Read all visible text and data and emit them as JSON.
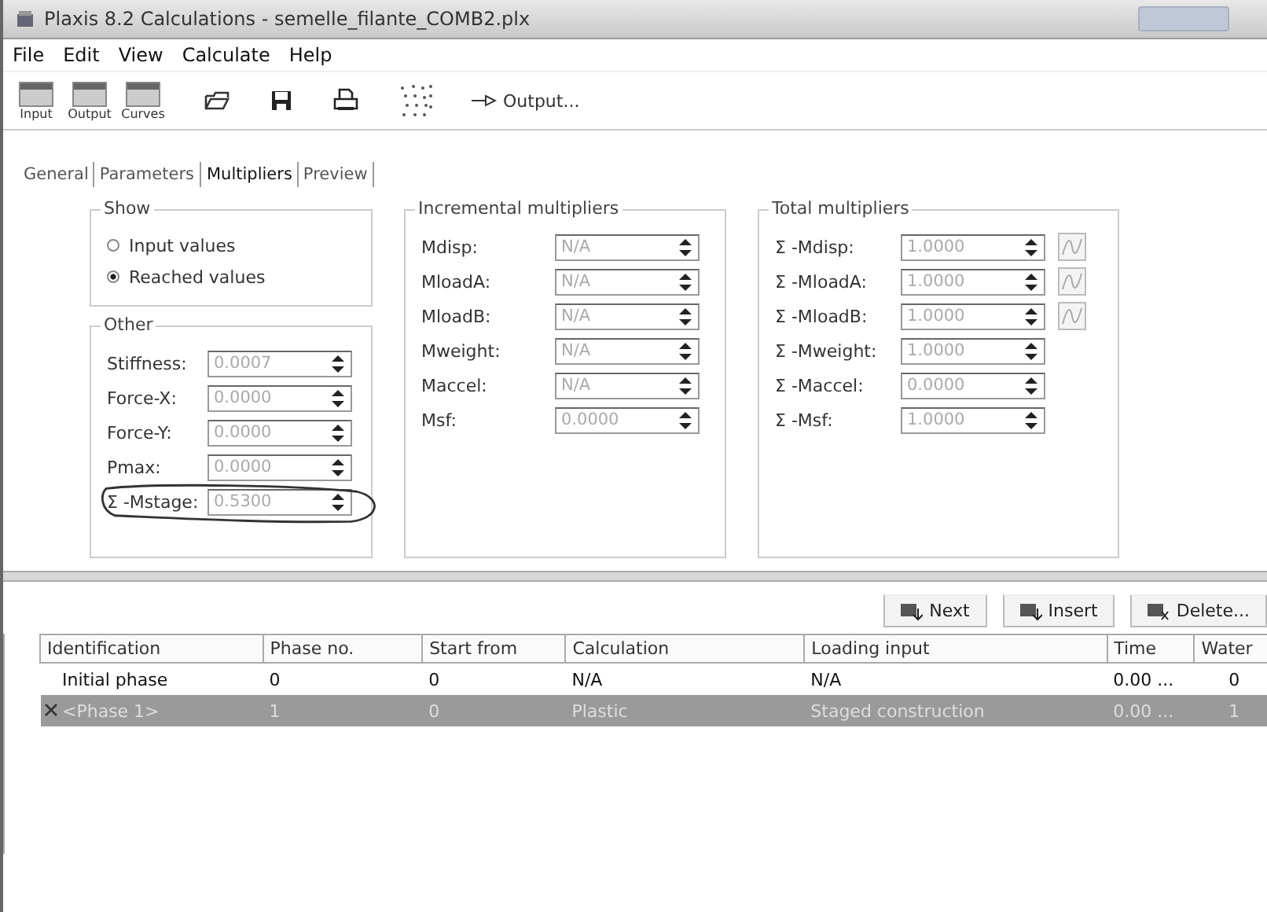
{
  "window": {
    "title": "Plaxis 8.2 Calculations - semelle_filante_COMB2.plx"
  },
  "menu": [
    "File",
    "Edit",
    "View",
    "Calculate",
    "Help"
  ],
  "toolbar": {
    "big_buttons": [
      {
        "label": "Input"
      },
      {
        "label": "Output"
      },
      {
        "label": "Curves"
      }
    ],
    "output_button": "Output..."
  },
  "tabs": [
    {
      "label": "General",
      "selected": false
    },
    {
      "label": "Parameters",
      "selected": false
    },
    {
      "label": "Multipliers",
      "selected": true
    },
    {
      "label": "Preview",
      "selected": false
    }
  ],
  "show": {
    "title": "Show",
    "options": [
      {
        "label": "Input values",
        "selected": false
      },
      {
        "label": "Reached values",
        "selected": true
      }
    ]
  },
  "other": {
    "title": "Other",
    "fields": [
      {
        "label": "Stiffness:",
        "value": "0.0007",
        "highlighted": false
      },
      {
        "label": "Force-X:",
        "value": "0.0000",
        "highlighted": false
      },
      {
        "label": "Force-Y:",
        "value": "0.0000",
        "highlighted": false
      },
      {
        "label": "Pmax:",
        "value": "0.0000",
        "highlighted": false
      },
      {
        "label": "Σ -Mstage:",
        "value": "0.5300",
        "highlighted": true
      }
    ]
  },
  "incremental": {
    "title": "Incremental multipliers",
    "fields": [
      {
        "label": "Mdisp:",
        "value": "N/A"
      },
      {
        "label": "MloadA:",
        "value": "N/A"
      },
      {
        "label": "MloadB:",
        "value": "N/A"
      },
      {
        "label": "Mweight:",
        "value": "N/A"
      },
      {
        "label": "Maccel:",
        "value": "N/A"
      },
      {
        "label": "Msf:",
        "value": "0.0000"
      }
    ]
  },
  "total": {
    "title": "Total multipliers",
    "fields": [
      {
        "label": "Σ -Mdisp:",
        "value": "1.0000",
        "curve_button": true
      },
      {
        "label": "Σ -MloadA:",
        "value": "1.0000",
        "curve_button": true
      },
      {
        "label": "Σ -MloadB:",
        "value": "1.0000",
        "curve_button": true
      },
      {
        "label": "Σ -Mweight:",
        "value": "1.0000",
        "curve_button": false
      },
      {
        "label": "Σ -Maccel:",
        "value": "0.0000",
        "curve_button": false
      },
      {
        "label": "Σ -Msf:",
        "value": "1.0000",
        "curve_button": false
      }
    ]
  },
  "phase_buttons": [
    "Next",
    "Insert",
    "Delete..."
  ],
  "table": {
    "columns": [
      "Identification",
      "Phase no.",
      "Start from",
      "Calculation",
      "Loading input",
      "Time",
      "Water"
    ],
    "rows": [
      {
        "cells": [
          "Initial phase",
          "0",
          "0",
          "N/A",
          "N/A",
          "0.00 ...",
          "0"
        ],
        "selected": false
      },
      {
        "cells": [
          "<Phase 1>",
          "1",
          "0",
          "Plastic",
          "Staged construction",
          "0.00 ...",
          "1"
        ],
        "selected": true
      }
    ]
  }
}
